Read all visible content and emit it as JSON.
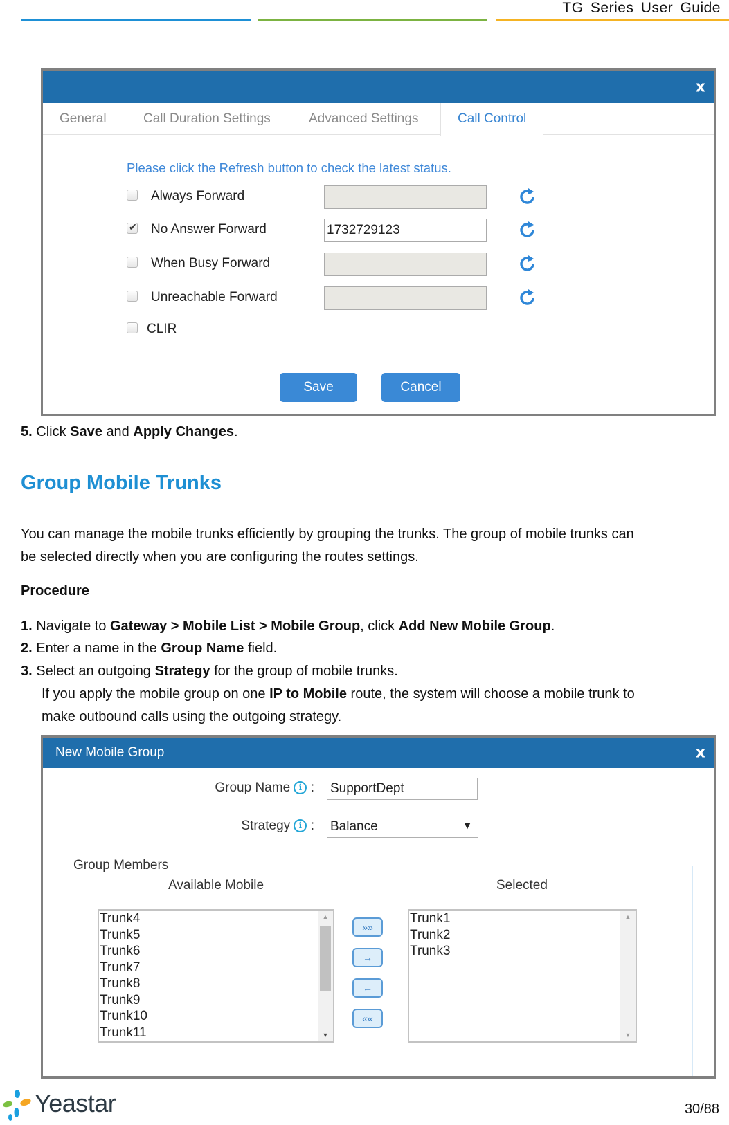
{
  "header": {
    "doc_title": "TG Series User Guide",
    "rule_colors": [
      "#1e90d6",
      "#7cb342",
      "#f5b323"
    ]
  },
  "call_control_dialog": {
    "close_label": "x",
    "tabs": [
      {
        "label": "General",
        "active": false
      },
      {
        "label": "Call Duration Settings",
        "active": false
      },
      {
        "label": "Advanced Settings",
        "active": false
      },
      {
        "label": "Call Control",
        "active": true
      }
    ],
    "notice": "Please click the Refresh button to check the latest status.",
    "rows": [
      {
        "label": "Always Forward",
        "checked": false,
        "value": "",
        "disabled": true
      },
      {
        "label": "No Answer Forward",
        "checked": true,
        "value": "1732729123",
        "disabled": false
      },
      {
        "label": "When Busy Forward",
        "checked": false,
        "value": "",
        "disabled": true
      },
      {
        "label": "Unreachable Forward",
        "checked": false,
        "value": "",
        "disabled": true
      }
    ],
    "clir": {
      "label": "CLIR",
      "checked": false
    },
    "save_label": "Save",
    "cancel_label": "Cancel",
    "accent_color": "#1f6eac",
    "button_color": "#3a89d6"
  },
  "step5": {
    "num": "5.",
    "pre": "Click",
    "b1": "Save",
    "mid": "and",
    "b2": "Apply Changes",
    "post": "."
  },
  "section": {
    "title": "Group Mobile Trunks",
    "intro_line1": "You can manage the mobile trunks efficiently by grouping the trunks. The group of mobile trunks can",
    "intro_line2": "be selected directly when you are configuring the routes settings.",
    "procedure_heading": "Procedure",
    "steps": [
      {
        "num": "1.",
        "parts": [
          {
            "t": "Navigate to ",
            "b": false
          },
          {
            "t": "Gateway > Mobile List > Mobile Group",
            "b": true
          },
          {
            "t": ", click ",
            "b": false
          },
          {
            "t": "Add New Mobile Group",
            "b": true
          },
          {
            "t": ".",
            "b": false
          }
        ]
      },
      {
        "num": "2.",
        "parts": [
          {
            "t": "Enter a name in the ",
            "b": false
          },
          {
            "t": "Group Name",
            "b": true
          },
          {
            "t": " field.",
            "b": false
          }
        ]
      },
      {
        "num": "3.",
        "parts": [
          {
            "t": "Select an outgoing ",
            "b": false
          },
          {
            "t": "Strategy",
            "b": true
          },
          {
            "t": " for the group of mobile trunks.",
            "b": false
          }
        ]
      }
    ],
    "note_line1_pre": "If you apply the mobile group on one ",
    "note_line1_bold": "IP to Mobile",
    "note_line1_post": " route, the system will choose a mobile trunk to",
    "note_line2": "make outbound calls using the outgoing strategy."
  },
  "mobile_group_dialog": {
    "title": "New Mobile Group",
    "close_label": "x",
    "group_name_label": "Group Name",
    "group_name_value": "SupportDept",
    "strategy_label": "Strategy",
    "strategy_value": "Balance",
    "colon": ":",
    "info_glyph": "i",
    "members_legend": "Group Members",
    "available_title": "Available Mobile",
    "selected_title": "Selected",
    "available": [
      "Trunk4",
      "Trunk5",
      "Trunk6",
      "Trunk7",
      "Trunk8",
      "Trunk9",
      "Trunk10",
      "Trunk11"
    ],
    "selected": [
      "Trunk1",
      "Trunk2",
      "Trunk3"
    ],
    "move_buttons": [
      {
        "name": "add-all-button",
        "glyph": "»»"
      },
      {
        "name": "add-button",
        "glyph": "→"
      },
      {
        "name": "remove-button",
        "glyph": "←"
      },
      {
        "name": "remove-all-button",
        "glyph": "««"
      }
    ]
  },
  "footer": {
    "logo_text": "Yeastar",
    "page": "30/88"
  }
}
